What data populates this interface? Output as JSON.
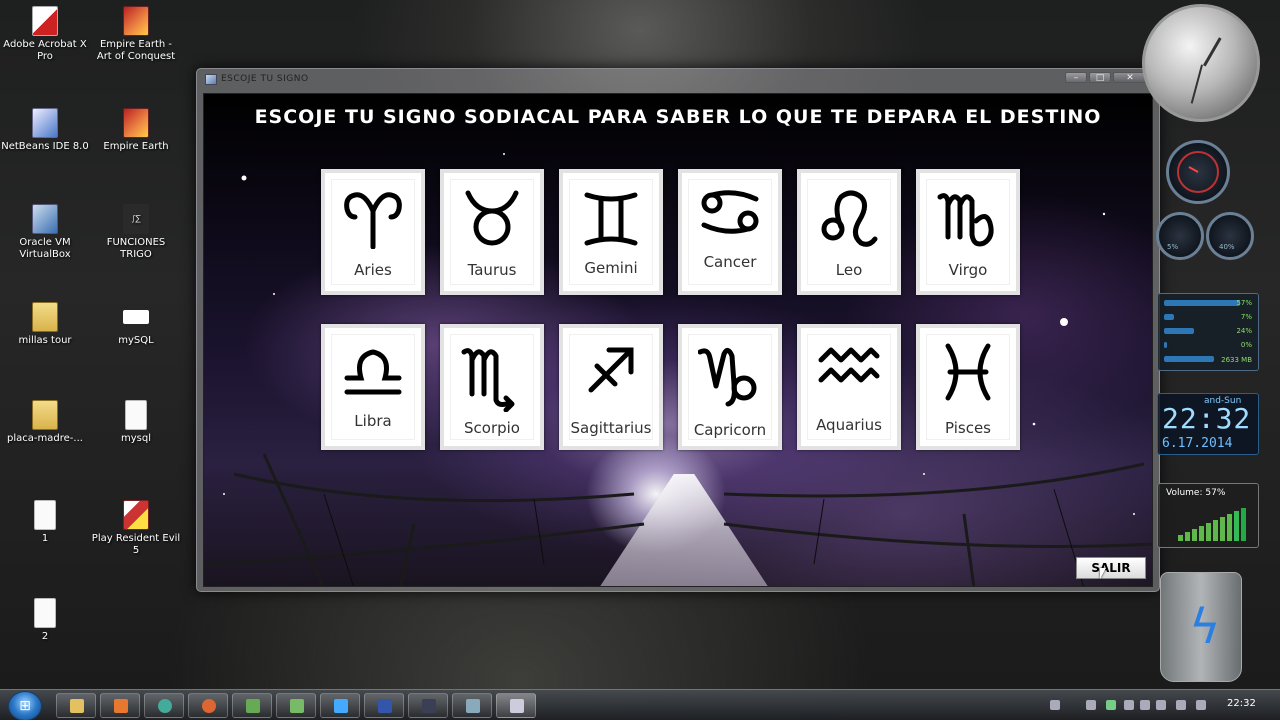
{
  "desktop": {
    "icons": [
      {
        "label": "Adobe Acrobat X Pro",
        "icon": "pdf-icon"
      },
      {
        "label": "Empire Earth - Art of Conquest",
        "icon": "game-icon"
      },
      {
        "label": "NetBeans IDE 8.0",
        "icon": "java-icon"
      },
      {
        "label": "Empire Earth",
        "icon": "game-icon"
      },
      {
        "label": "Oracle VM VirtualBox",
        "icon": "virtualbox-icon"
      },
      {
        "label": "FUNCIONES TRIGO",
        "icon": "trig-icon"
      },
      {
        "label": "millas tour",
        "icon": "folder-icon"
      },
      {
        "label": "mySQL",
        "icon": "sql-icon"
      },
      {
        "label": "placa-madre-...",
        "icon": "folder-icon"
      },
      {
        "label": "mysql",
        "icon": "file-icon"
      },
      {
        "label": "1",
        "icon": "file-icon"
      },
      {
        "label": "Play Resident Evil 5",
        "icon": "game-icon"
      },
      {
        "label": "2",
        "icon": "file-icon"
      }
    ]
  },
  "window": {
    "title": "ESCOJE TU SIGNO",
    "buttons": {
      "minimize": "–",
      "maximize": "□",
      "close": "✕"
    },
    "heading": "ESCOJE TU SIGNO SODIACAL PARA SABER LO QUE TE DEPARA EL DESTINO",
    "signs": [
      {
        "name": "Aries",
        "icon": "aries-icon"
      },
      {
        "name": "Taurus",
        "icon": "taurus-icon"
      },
      {
        "name": "Gemini",
        "icon": "gemini-icon"
      },
      {
        "name": "Cancer",
        "icon": "cancer-icon"
      },
      {
        "name": "Leo",
        "icon": "leo-icon"
      },
      {
        "name": "Virgo",
        "icon": "virgo-icon"
      },
      {
        "name": "Libra",
        "icon": "libra-icon"
      },
      {
        "name": "Scorpio",
        "icon": "scorpio-icon"
      },
      {
        "name": "Sagittarius",
        "icon": "sagittarius-icon"
      },
      {
        "name": "Capricorn",
        "icon": "capricorn-icon"
      },
      {
        "name": "Aquarius",
        "icon": "aquarius-icon"
      },
      {
        "name": "Pisces",
        "icon": "pisces-icon"
      }
    ],
    "exit_button": "SALIR"
  },
  "gadgets": {
    "cpu_left": "5%",
    "cpu_right": "40%",
    "meters": [
      "57%",
      "7%",
      "24%",
      "0%",
      "2633 MB"
    ],
    "day": "and-Sun",
    "time": "22:32",
    "date": "6.17.2014",
    "volume": "Volume: 57%"
  },
  "taskbar": {
    "clock": "22:32"
  },
  "colors": {
    "heading_text": "#ffffff",
    "card_bg": "#ffffff",
    "card_border": "#e2e2e2",
    "glyph": "#000000"
  }
}
